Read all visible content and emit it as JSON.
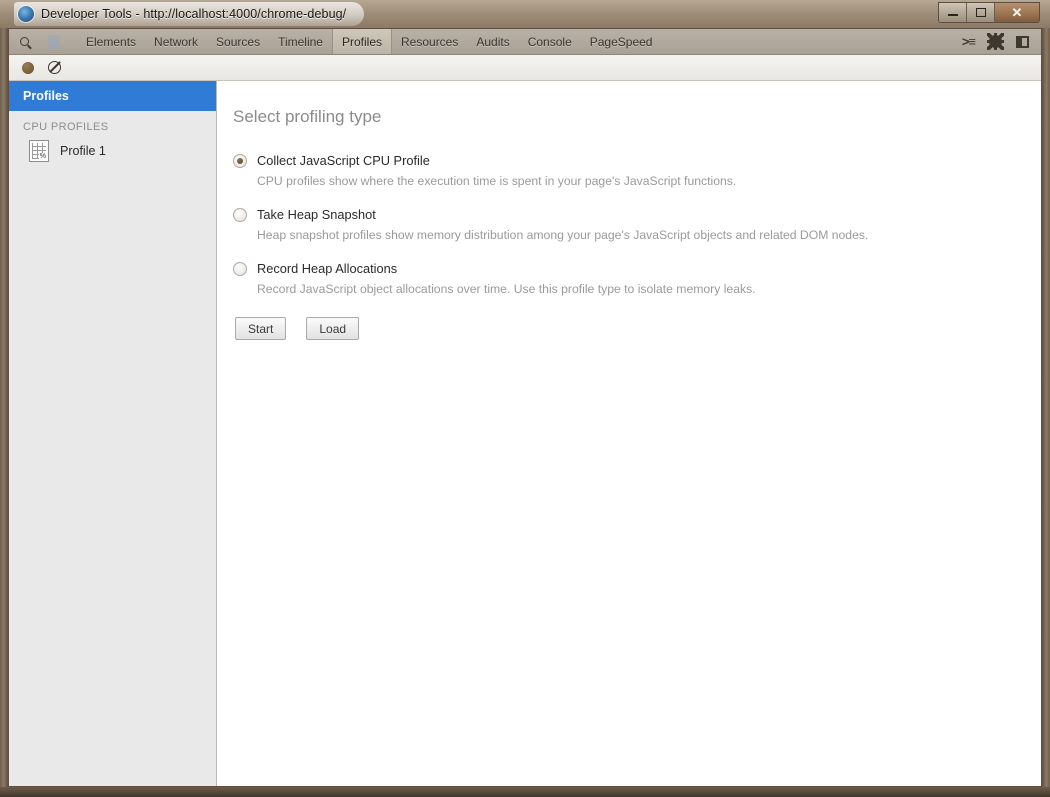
{
  "window": {
    "title": "Developer Tools - http://localhost:4000/chrome-debug/",
    "app_icon": "chrome-devtools-icon",
    "controls": {
      "minimize": "minimize-button",
      "maximize": "maximize-button",
      "close_label": "✕"
    }
  },
  "tabbar": {
    "search_icon": "search-icon",
    "inspect_icon": "inspect-element-icon",
    "tabs": [
      {
        "label": "Elements",
        "selected": false
      },
      {
        "label": "Network",
        "selected": false
      },
      {
        "label": "Sources",
        "selected": false
      },
      {
        "label": "Timeline",
        "selected": false
      },
      {
        "label": "Profiles",
        "selected": true
      },
      {
        "label": "Resources",
        "selected": false
      },
      {
        "label": "Audits",
        "selected": false
      },
      {
        "label": "Console",
        "selected": false
      },
      {
        "label": "PageSpeed",
        "selected": false
      }
    ],
    "right_icons": {
      "drawer": ">≡",
      "settings": "gear-icon",
      "dock": "dock-panel-icon"
    }
  },
  "statusbar": {
    "record_icon": "record-button",
    "clear_icon": "clear-profiles-button"
  },
  "sidebar": {
    "header": "Profiles",
    "section_label": "CPU PROFILES",
    "items": [
      {
        "label": "Profile 1",
        "icon": "cpu-profile-icon",
        "icon_badge": "%"
      }
    ]
  },
  "main": {
    "title": "Select profiling type",
    "options": [
      {
        "label": "Collect JavaScript CPU Profile",
        "description": "CPU profiles show where the execution time is spent in your page's JavaScript functions.",
        "selected": true
      },
      {
        "label": "Take Heap Snapshot",
        "description": "Heap snapshot profiles show memory distribution among your page's JavaScript objects and related DOM nodes.",
        "selected": false
      },
      {
        "label": "Record Heap Allocations",
        "description": "Record JavaScript object allocations over time. Use this profile type to isolate memory leaks.",
        "selected": false
      }
    ],
    "buttons": {
      "start": "Start",
      "load": "Load"
    }
  },
  "colors": {
    "sidebar_selected": "#2f7bd6",
    "frame": "#6e5e4c",
    "radio_dot": "#6b5635"
  }
}
